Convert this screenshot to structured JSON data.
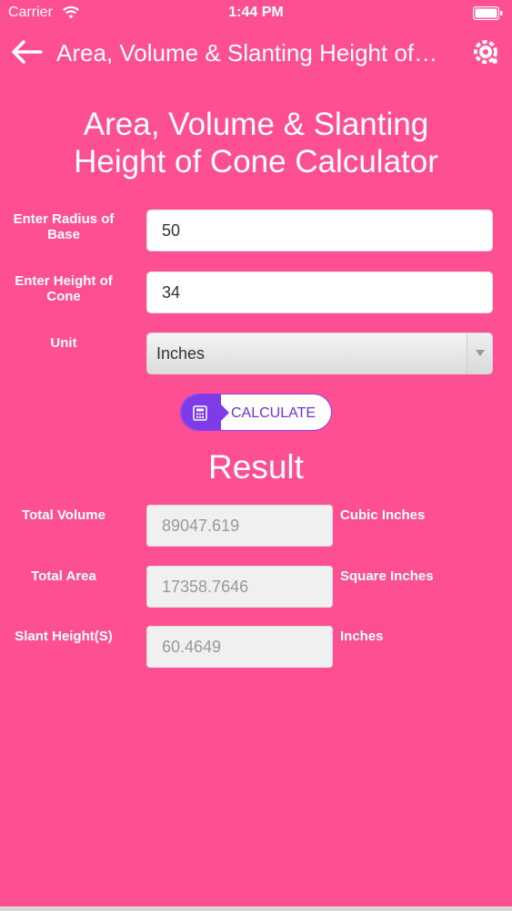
{
  "status_bar": {
    "carrier": "Carrier",
    "time": "1:44 PM"
  },
  "nav": {
    "title": "Area, Volume & Slanting Height of…",
    "back_icon": "back-arrow-icon",
    "menu_icon": "settings-gear-icon"
  },
  "page": {
    "title_line1": "Area, Volume & Slanting",
    "title_line2": "Height of Cone Calculator"
  },
  "form": {
    "radius_label_line1": "Enter Radius of",
    "radius_label_line2": "Base",
    "radius_value": "50",
    "height_label_line1": "Enter Height of",
    "height_label_line2": "Cone",
    "height_value": "34",
    "unit_label": "Unit",
    "unit_value": "Inches",
    "calculate_label": "CALCULATE"
  },
  "result": {
    "title": "Result",
    "volume_label": "Total Volume",
    "volume_value": "89047.619",
    "volume_unit": "Cubic Inches",
    "area_label": "Total Area",
    "area_value": "17358.7646",
    "area_unit": "Square Inches",
    "slant_label": "Slant Height(S)",
    "slant_value": "60.4649",
    "slant_unit": "Inches"
  },
  "colors": {
    "background": "#FE4F93",
    "accent": "#7D3CE8"
  }
}
